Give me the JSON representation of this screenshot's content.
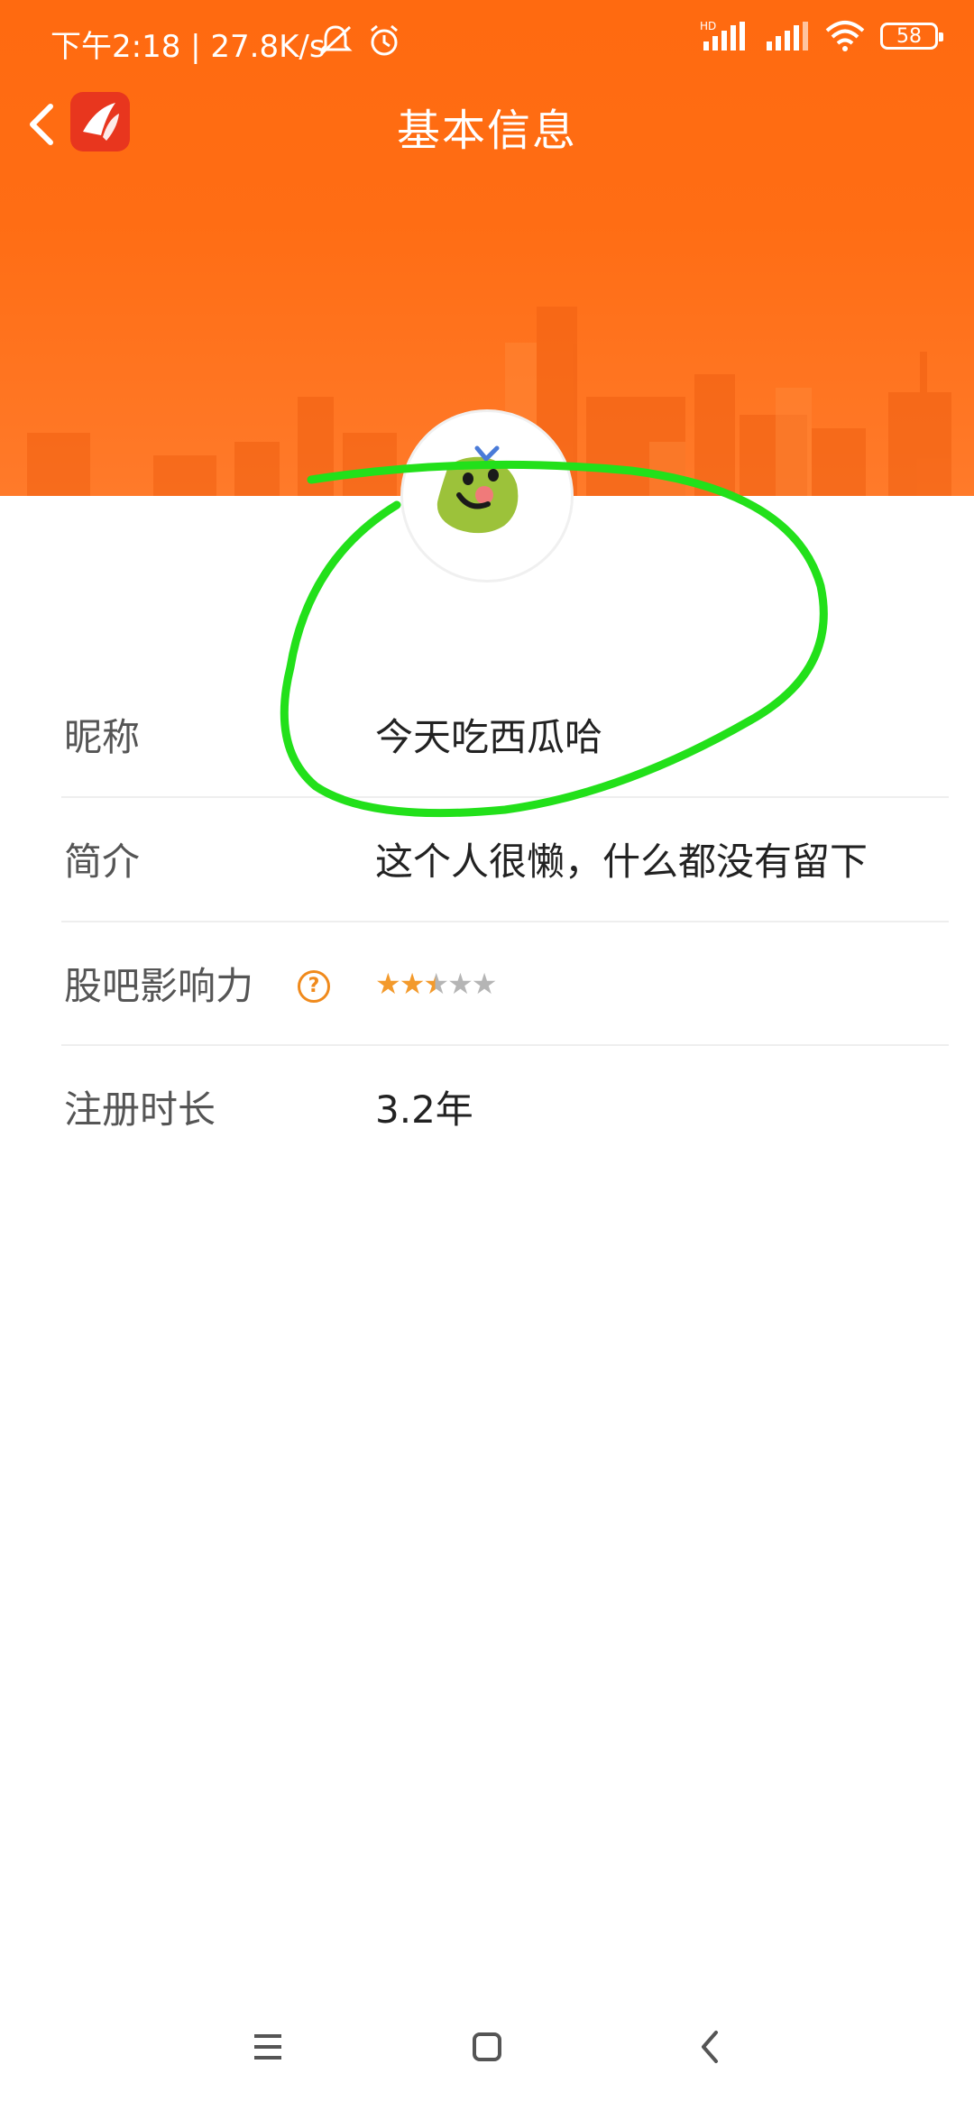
{
  "status_bar": {
    "time_speed": "下午2:18 | 27.8K/s",
    "battery": "58",
    "icons": [
      "mute-icon",
      "alarm-icon",
      "hd-signal-icon",
      "signal-icon",
      "wifi-icon",
      "battery-icon"
    ]
  },
  "header": {
    "title": "基本信息",
    "accent_color": "#ff6a10"
  },
  "profile": {
    "rows": [
      {
        "label": "昵称",
        "value": "今天吃西瓜哈"
      },
      {
        "label": "简介",
        "value": "这个人很懒，什么都没有留下"
      },
      {
        "label": "股吧影响力",
        "rating": 2.5,
        "max": 5
      },
      {
        "label": "注册时长",
        "value": "3.2年"
      }
    ]
  },
  "annotation_color": "#22e01a",
  "nav_bar": {
    "icons": [
      "menu-icon",
      "home-icon",
      "back-icon"
    ]
  }
}
